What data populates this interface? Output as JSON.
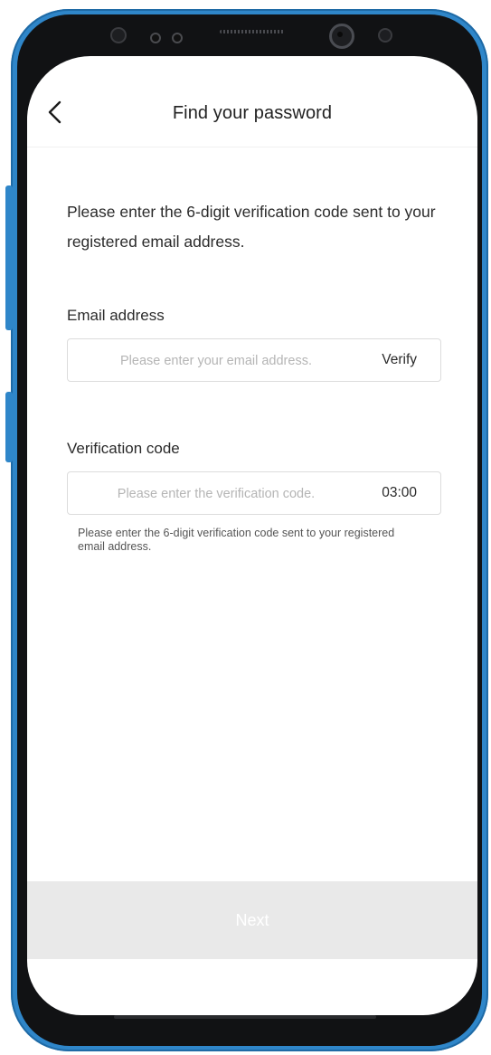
{
  "header": {
    "title": "Find your password",
    "back_icon": "chevron-left-icon"
  },
  "intro_text": "Please enter the 6-digit verification code sent to your registered email address.",
  "email": {
    "label": "Email address",
    "placeholder": "Please enter your email address.",
    "value": "",
    "verify_label": "Verify"
  },
  "code": {
    "label": "Verification code",
    "placeholder": "Please enter the verification code.",
    "value": "",
    "timer": "03:00",
    "helper": "Please enter the 6-digit verification code sent to your registered email address."
  },
  "next_label": "Next",
  "colors": {
    "phone_frame": "#2f86c9",
    "button_disabled_bg": "#e9e9e9",
    "text_primary": "#222222",
    "placeholder": "#b5b5b5",
    "border": "#dcdcdc"
  }
}
